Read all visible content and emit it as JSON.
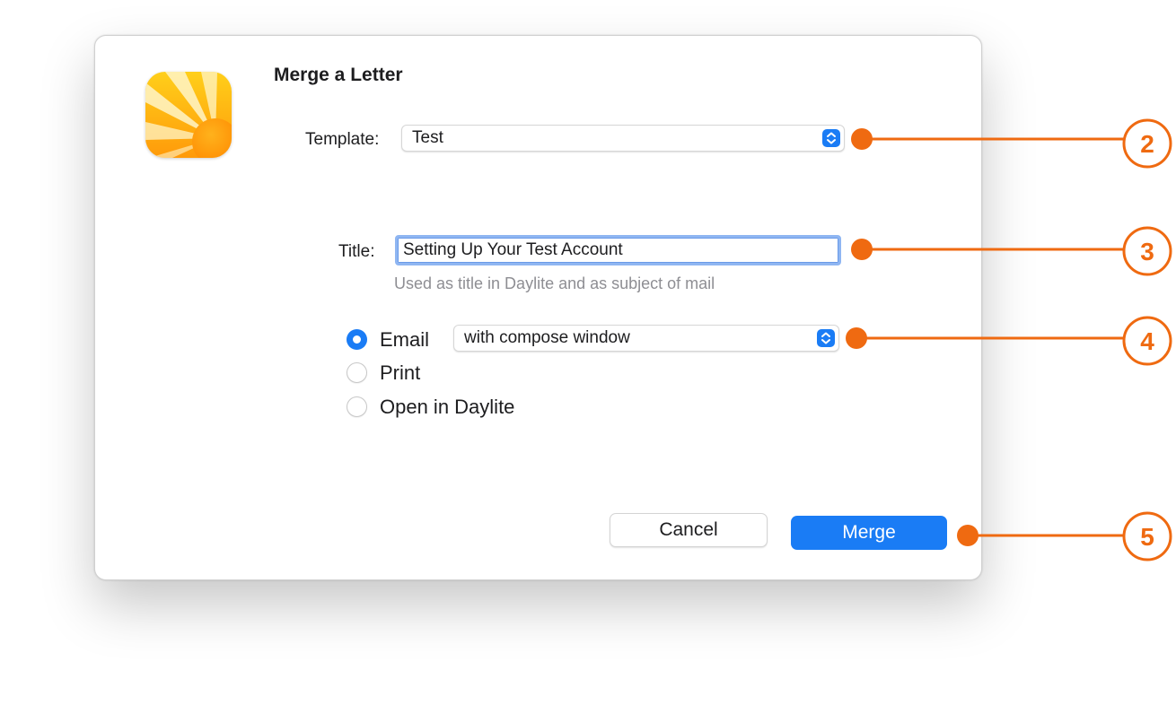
{
  "dialog": {
    "title": "Merge a Letter",
    "app_icon": "daylite-app-icon",
    "template": {
      "label": "Template:",
      "value": "Test"
    },
    "title_field": {
      "label": "Title:",
      "value": "Setting Up Your Test Account",
      "hint": "Used as title in Daylite and  as subject of mail"
    },
    "output_options": [
      {
        "label": "Email",
        "selected": true
      },
      {
        "label": "Print",
        "selected": false
      },
      {
        "label": "Open in Daylite",
        "selected": false
      }
    ],
    "email_mode": {
      "value": "with compose window"
    },
    "buttons": {
      "cancel": "Cancel",
      "merge": "Merge"
    }
  },
  "callouts": [
    {
      "number": "2",
      "target": "template-popup"
    },
    {
      "number": "3",
      "target": "title-field"
    },
    {
      "number": "4",
      "target": "email-mode-popup"
    },
    {
      "number": "5",
      "target": "merge-button"
    }
  ],
  "colors": {
    "accent": "#1a7cf5",
    "callout": "#ef6a11"
  }
}
